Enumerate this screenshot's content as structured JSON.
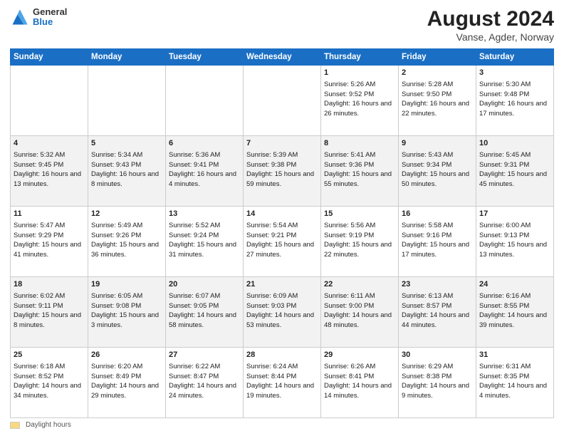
{
  "header": {
    "logo_line1": "General",
    "logo_line2": "Blue",
    "title": "August 2024",
    "subtitle": "Vanse, Agder, Norway"
  },
  "footer": {
    "label": "Daylight hours"
  },
  "columns": [
    "Sunday",
    "Monday",
    "Tuesday",
    "Wednesday",
    "Thursday",
    "Friday",
    "Saturday"
  ],
  "weeks": [
    [
      {
        "day": "",
        "sunrise": "",
        "sunset": "",
        "daylight": ""
      },
      {
        "day": "",
        "sunrise": "",
        "sunset": "",
        "daylight": ""
      },
      {
        "day": "",
        "sunrise": "",
        "sunset": "",
        "daylight": ""
      },
      {
        "day": "",
        "sunrise": "",
        "sunset": "",
        "daylight": ""
      },
      {
        "day": "1",
        "sunrise": "Sunrise: 5:26 AM",
        "sunset": "Sunset: 9:52 PM",
        "daylight": "Daylight: 16 hours and 26 minutes."
      },
      {
        "day": "2",
        "sunrise": "Sunrise: 5:28 AM",
        "sunset": "Sunset: 9:50 PM",
        "daylight": "Daylight: 16 hours and 22 minutes."
      },
      {
        "day": "3",
        "sunrise": "Sunrise: 5:30 AM",
        "sunset": "Sunset: 9:48 PM",
        "daylight": "Daylight: 16 hours and 17 minutes."
      }
    ],
    [
      {
        "day": "4",
        "sunrise": "Sunrise: 5:32 AM",
        "sunset": "Sunset: 9:45 PM",
        "daylight": "Daylight: 16 hours and 13 minutes."
      },
      {
        "day": "5",
        "sunrise": "Sunrise: 5:34 AM",
        "sunset": "Sunset: 9:43 PM",
        "daylight": "Daylight: 16 hours and 8 minutes."
      },
      {
        "day": "6",
        "sunrise": "Sunrise: 5:36 AM",
        "sunset": "Sunset: 9:41 PM",
        "daylight": "Daylight: 16 hours and 4 minutes."
      },
      {
        "day": "7",
        "sunrise": "Sunrise: 5:39 AM",
        "sunset": "Sunset: 9:38 PM",
        "daylight": "Daylight: 15 hours and 59 minutes."
      },
      {
        "day": "8",
        "sunrise": "Sunrise: 5:41 AM",
        "sunset": "Sunset: 9:36 PM",
        "daylight": "Daylight: 15 hours and 55 minutes."
      },
      {
        "day": "9",
        "sunrise": "Sunrise: 5:43 AM",
        "sunset": "Sunset: 9:34 PM",
        "daylight": "Daylight: 15 hours and 50 minutes."
      },
      {
        "day": "10",
        "sunrise": "Sunrise: 5:45 AM",
        "sunset": "Sunset: 9:31 PM",
        "daylight": "Daylight: 15 hours and 45 minutes."
      }
    ],
    [
      {
        "day": "11",
        "sunrise": "Sunrise: 5:47 AM",
        "sunset": "Sunset: 9:29 PM",
        "daylight": "Daylight: 15 hours and 41 minutes."
      },
      {
        "day": "12",
        "sunrise": "Sunrise: 5:49 AM",
        "sunset": "Sunset: 9:26 PM",
        "daylight": "Daylight: 15 hours and 36 minutes."
      },
      {
        "day": "13",
        "sunrise": "Sunrise: 5:52 AM",
        "sunset": "Sunset: 9:24 PM",
        "daylight": "Daylight: 15 hours and 31 minutes."
      },
      {
        "day": "14",
        "sunrise": "Sunrise: 5:54 AM",
        "sunset": "Sunset: 9:21 PM",
        "daylight": "Daylight: 15 hours and 27 minutes."
      },
      {
        "day": "15",
        "sunrise": "Sunrise: 5:56 AM",
        "sunset": "Sunset: 9:19 PM",
        "daylight": "Daylight: 15 hours and 22 minutes."
      },
      {
        "day": "16",
        "sunrise": "Sunrise: 5:58 AM",
        "sunset": "Sunset: 9:16 PM",
        "daylight": "Daylight: 15 hours and 17 minutes."
      },
      {
        "day": "17",
        "sunrise": "Sunrise: 6:00 AM",
        "sunset": "Sunset: 9:13 PM",
        "daylight": "Daylight: 15 hours and 13 minutes."
      }
    ],
    [
      {
        "day": "18",
        "sunrise": "Sunrise: 6:02 AM",
        "sunset": "Sunset: 9:11 PM",
        "daylight": "Daylight: 15 hours and 8 minutes."
      },
      {
        "day": "19",
        "sunrise": "Sunrise: 6:05 AM",
        "sunset": "Sunset: 9:08 PM",
        "daylight": "Daylight: 15 hours and 3 minutes."
      },
      {
        "day": "20",
        "sunrise": "Sunrise: 6:07 AM",
        "sunset": "Sunset: 9:05 PM",
        "daylight": "Daylight: 14 hours and 58 minutes."
      },
      {
        "day": "21",
        "sunrise": "Sunrise: 6:09 AM",
        "sunset": "Sunset: 9:03 PM",
        "daylight": "Daylight: 14 hours and 53 minutes."
      },
      {
        "day": "22",
        "sunrise": "Sunrise: 6:11 AM",
        "sunset": "Sunset: 9:00 PM",
        "daylight": "Daylight: 14 hours and 48 minutes."
      },
      {
        "day": "23",
        "sunrise": "Sunrise: 6:13 AM",
        "sunset": "Sunset: 8:57 PM",
        "daylight": "Daylight: 14 hours and 44 minutes."
      },
      {
        "day": "24",
        "sunrise": "Sunrise: 6:16 AM",
        "sunset": "Sunset: 8:55 PM",
        "daylight": "Daylight: 14 hours and 39 minutes."
      }
    ],
    [
      {
        "day": "25",
        "sunrise": "Sunrise: 6:18 AM",
        "sunset": "Sunset: 8:52 PM",
        "daylight": "Daylight: 14 hours and 34 minutes."
      },
      {
        "day": "26",
        "sunrise": "Sunrise: 6:20 AM",
        "sunset": "Sunset: 8:49 PM",
        "daylight": "Daylight: 14 hours and 29 minutes."
      },
      {
        "day": "27",
        "sunrise": "Sunrise: 6:22 AM",
        "sunset": "Sunset: 8:47 PM",
        "daylight": "Daylight: 14 hours and 24 minutes."
      },
      {
        "day": "28",
        "sunrise": "Sunrise: 6:24 AM",
        "sunset": "Sunset: 8:44 PM",
        "daylight": "Daylight: 14 hours and 19 minutes."
      },
      {
        "day": "29",
        "sunrise": "Sunrise: 6:26 AM",
        "sunset": "Sunset: 8:41 PM",
        "daylight": "Daylight: 14 hours and 14 minutes."
      },
      {
        "day": "30",
        "sunrise": "Sunrise: 6:29 AM",
        "sunset": "Sunset: 8:38 PM",
        "daylight": "Daylight: 14 hours and 9 minutes."
      },
      {
        "day": "31",
        "sunrise": "Sunrise: 6:31 AM",
        "sunset": "Sunset: 8:35 PM",
        "daylight": "Daylight: 14 hours and 4 minutes."
      }
    ]
  ]
}
